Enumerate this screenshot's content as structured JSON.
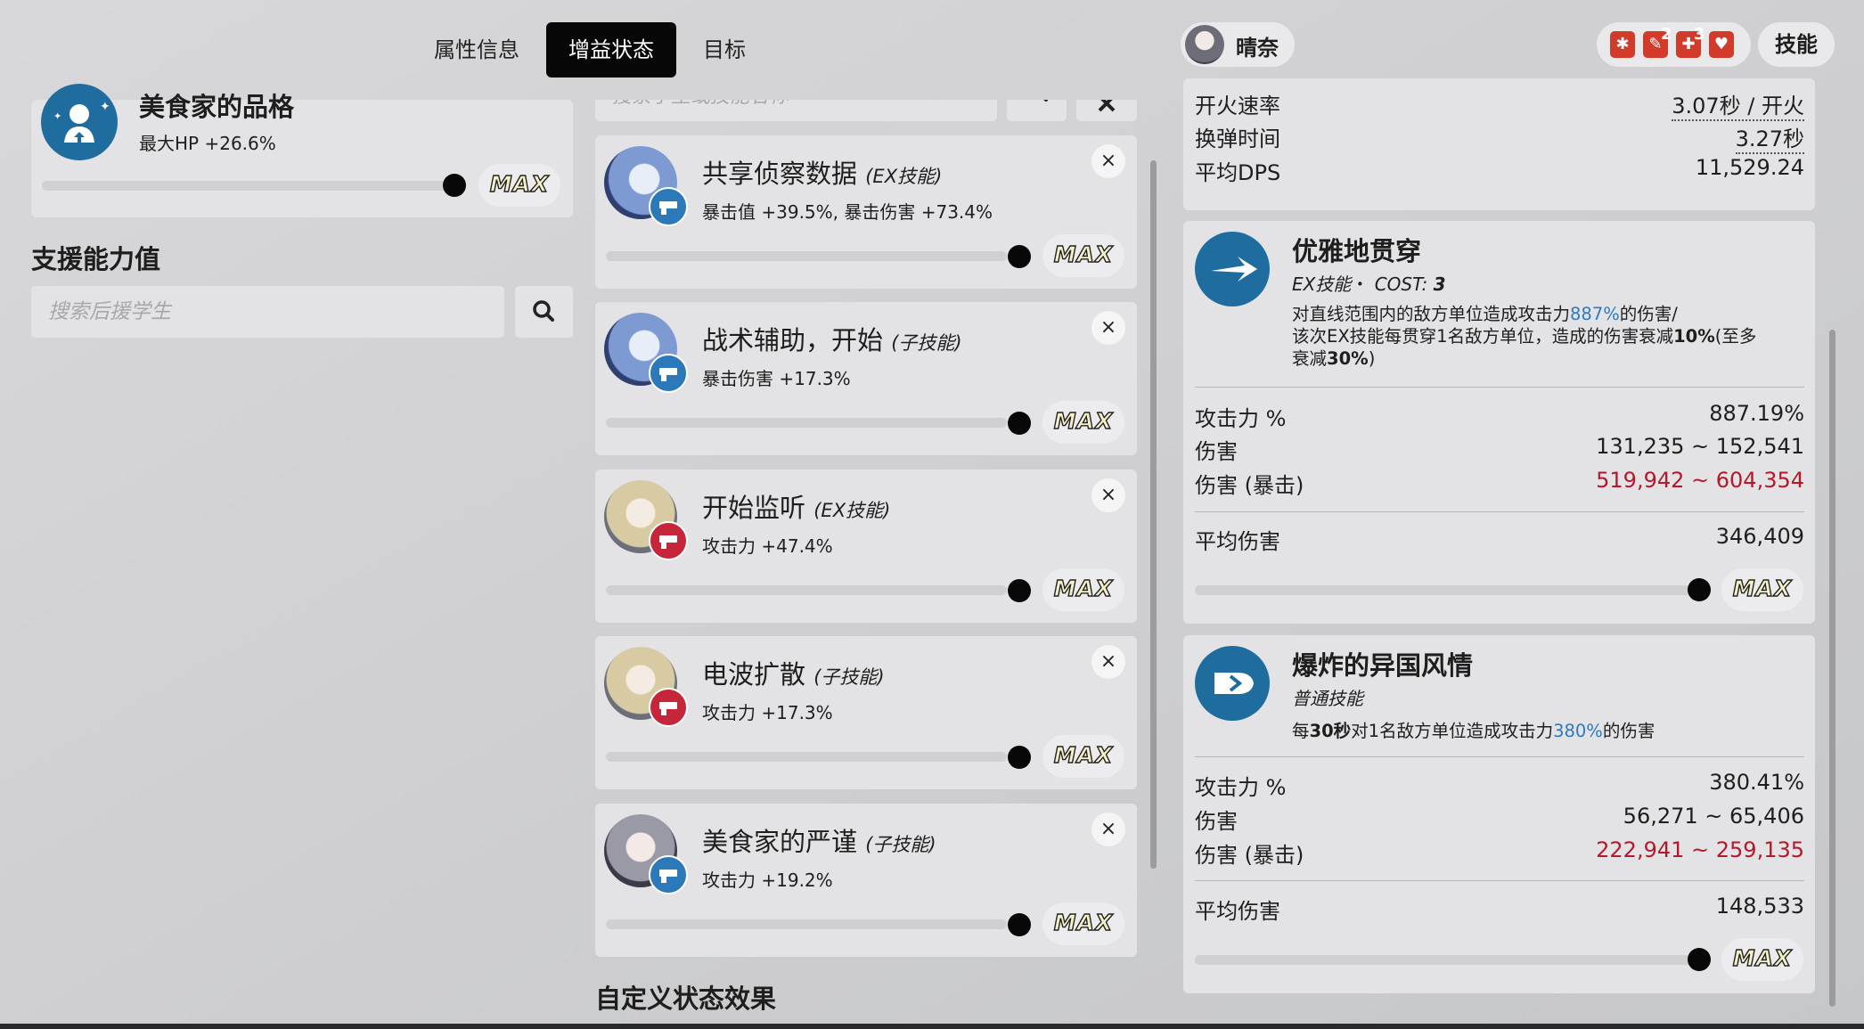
{
  "tabs": [
    "属性信息",
    "增益状态",
    "目标"
  ],
  "student": {
    "name": "晴奈",
    "skills_button": "技能"
  },
  "equipment_badges": [
    "2",
    "3"
  ],
  "left": {
    "top_card": {
      "title": "美食家的品格",
      "effect": "最大HP +26.6%"
    },
    "support_heading": "支援能力值",
    "support_search_placeholder": "搜索后援学生"
  },
  "middle": {
    "search_placeholder": "搜索学生或技能名称",
    "buffs": [
      {
        "title": "共享侦察数据",
        "type": "(EX技能)",
        "effect": "暴击值 +39.5%, 暴击伤害 +73.4%"
      },
      {
        "title": "战术辅助，开始",
        "type": "(子技能)",
        "effect": "暴击伤害 +17.3%"
      },
      {
        "title": "开始监听",
        "type": "(EX技能)",
        "effect": "攻击力 +47.4%"
      },
      {
        "title": "电波扩散",
        "type": "(子技能)",
        "effect": "攻击力 +17.3%"
      },
      {
        "title": "美食家的严谨",
        "type": "(子技能)",
        "effect": "攻击力 +19.2%"
      }
    ],
    "custom_heading": "自定义状态效果",
    "close_symbol": "×"
  },
  "max_label": "MAX",
  "right": {
    "stats": [
      {
        "label": "开火速率",
        "value": "3.07秒 / 开火"
      },
      {
        "label": "换弹时间",
        "value": "3.27秒"
      },
      {
        "label": "平均DPS",
        "value": "11,529.24"
      }
    ],
    "skill1": {
      "name": "优雅地贯穿",
      "type": "EX技能",
      "cost_sep": "・",
      "cost_label": "COST:",
      "cost": "3",
      "desc": {
        "a": "对直线范围内的敌方单位造成攻击力",
        "pct": "887%",
        "b": "的伤害/",
        "c": "该次EX技能每贯穿1名敌方单位，造成的伤害衰减",
        "d": "10%",
        "e": "(至多",
        "f": "衰减",
        "g": "30%",
        "h": ")"
      },
      "atk_label": "攻击力 %",
      "atk": "887.19%",
      "dmg_label": "伤害",
      "dmg": "131,235 ~ 152,541",
      "crit_label": "伤害 (暴击)",
      "crit": "519,942 ~ 604,354",
      "avg_label": "平均伤害",
      "avg": "346,409"
    },
    "skill2": {
      "name": "爆炸的异国风情",
      "type": "普通技能",
      "desc": {
        "a": "每",
        "b": "30秒",
        "c": "对1名敌方单位造成攻击力",
        "pct": "380%",
        "d": "的伤害"
      },
      "atk_label": "攻击力 %",
      "atk": "380.41%",
      "dmg_label": "伤害",
      "dmg": "56,271 ~ 65,406",
      "crit_label": "伤害 (暴击)",
      "crit": "222,941 ~ 259,135",
      "avg_label": "平均伤害",
      "avg": "148,533"
    }
  },
  "colors": {
    "accent_dark": "#070707",
    "skill_icon": "#1f6d9e",
    "crit_red": "#b5172b",
    "highlight_blue": "#2c7bc1",
    "badge_red": "#c6263a",
    "badge_blue": "#2b79b8"
  },
  "icons": [
    "search-icon",
    "settings-icon",
    "close-icon",
    "gun-icon",
    "arrow-pierce-icon",
    "bullet-icon",
    "heal-icon"
  ]
}
